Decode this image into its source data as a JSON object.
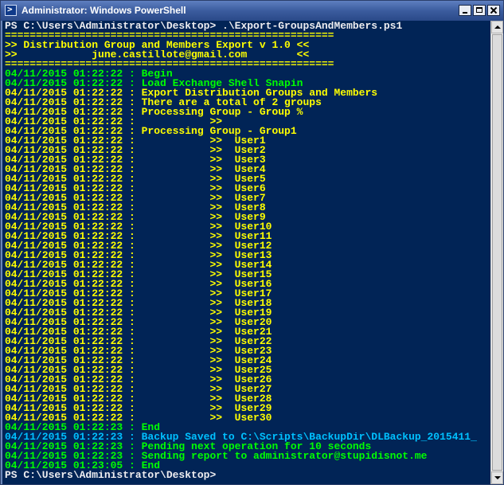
{
  "window": {
    "title": "Administrator: Windows PowerShell",
    "icon": "powershell-icon"
  },
  "colors": {
    "background": "#012456",
    "foreground": "#eeedf0",
    "yellow": "#ffff00",
    "green": "#00ff00",
    "cyan": "#00c0ff"
  },
  "console": {
    "lines": [
      {
        "text": "PS C:\\Users\\Administrator\\Desktop> .\\Export-GroupsAndMembers.ps1",
        "color": "#eeedf0"
      },
      {
        "text": "=====================================================",
        "color": "#ffff00"
      },
      {
        "text": ">> Distribution Group and Members Export v 1.0 <<",
        "color": "#ffff00"
      },
      {
        "text": ">>            june.castillote@gmail.com        <<",
        "color": "#ffff00"
      },
      {
        "text": "=====================================================",
        "color": "#ffff00"
      },
      {
        "text": "04/11/2015 01:22:22 : Begin",
        "color": "#00ff00"
      },
      {
        "text": "04/11/2015 01:22:22 : Load Exchange Shell Snapin",
        "color": "#00ff00"
      },
      {
        "text": "04/11/2015 01:22:22 : Export Distribution Groups and Members",
        "color": "#ffff00"
      },
      {
        "text": "04/11/2015 01:22:22 : There are a total of 2 groups",
        "color": "#ffff00"
      },
      {
        "text": "04/11/2015 01:22:22 : Processing Group - Group %",
        "color": "#ffff00"
      },
      {
        "text": "04/11/2015 01:22:22 :            >>",
        "color": "#ffff00"
      },
      {
        "text": "04/11/2015 01:22:22 : Processing Group - Group1",
        "color": "#ffff00"
      },
      {
        "text": "04/11/2015 01:22:22 :            >>  User1",
        "color": "#ffff00"
      },
      {
        "text": "04/11/2015 01:22:22 :            >>  User2",
        "color": "#ffff00"
      },
      {
        "text": "04/11/2015 01:22:22 :            >>  User3",
        "color": "#ffff00"
      },
      {
        "text": "04/11/2015 01:22:22 :            >>  User4",
        "color": "#ffff00"
      },
      {
        "text": "04/11/2015 01:22:22 :            >>  User5",
        "color": "#ffff00"
      },
      {
        "text": "04/11/2015 01:22:22 :            >>  User6",
        "color": "#ffff00"
      },
      {
        "text": "04/11/2015 01:22:22 :            >>  User7",
        "color": "#ffff00"
      },
      {
        "text": "04/11/2015 01:22:22 :            >>  User8",
        "color": "#ffff00"
      },
      {
        "text": "04/11/2015 01:22:22 :            >>  User9",
        "color": "#ffff00"
      },
      {
        "text": "04/11/2015 01:22:22 :            >>  User10",
        "color": "#ffff00"
      },
      {
        "text": "04/11/2015 01:22:22 :            >>  User11",
        "color": "#ffff00"
      },
      {
        "text": "04/11/2015 01:22:22 :            >>  User12",
        "color": "#ffff00"
      },
      {
        "text": "04/11/2015 01:22:22 :            >>  User13",
        "color": "#ffff00"
      },
      {
        "text": "04/11/2015 01:22:22 :            >>  User14",
        "color": "#ffff00"
      },
      {
        "text": "04/11/2015 01:22:22 :            >>  User15",
        "color": "#ffff00"
      },
      {
        "text": "04/11/2015 01:22:22 :            >>  User16",
        "color": "#ffff00"
      },
      {
        "text": "04/11/2015 01:22:22 :            >>  User17",
        "color": "#ffff00"
      },
      {
        "text": "04/11/2015 01:22:22 :            >>  User18",
        "color": "#ffff00"
      },
      {
        "text": "04/11/2015 01:22:22 :            >>  User19",
        "color": "#ffff00"
      },
      {
        "text": "04/11/2015 01:22:22 :            >>  User20",
        "color": "#ffff00"
      },
      {
        "text": "04/11/2015 01:22:22 :            >>  User21",
        "color": "#ffff00"
      },
      {
        "text": "04/11/2015 01:22:22 :            >>  User22",
        "color": "#ffff00"
      },
      {
        "text": "04/11/2015 01:22:22 :            >>  User23",
        "color": "#ffff00"
      },
      {
        "text": "04/11/2015 01:22:22 :            >>  User24",
        "color": "#ffff00"
      },
      {
        "text": "04/11/2015 01:22:22 :            >>  User25",
        "color": "#ffff00"
      },
      {
        "text": "04/11/2015 01:22:22 :            >>  User26",
        "color": "#ffff00"
      },
      {
        "text": "04/11/2015 01:22:22 :            >>  User27",
        "color": "#ffff00"
      },
      {
        "text": "04/11/2015 01:22:22 :            >>  User28",
        "color": "#ffff00"
      },
      {
        "text": "04/11/2015 01:22:22 :            >>  User29",
        "color": "#ffff00"
      },
      {
        "text": "04/11/2015 01:22:22 :            >>  User30",
        "color": "#ffff00"
      },
      {
        "text": "04/11/2015 01:22:23 : End",
        "color": "#00ff00"
      },
      {
        "text": "04/11/2015 01:22:23 : Backup Saved to C:\\Scripts\\BackupDir\\DLBackup_2015411_",
        "color": "#00c0ff"
      },
      {
        "text": "04/11/2015 01:22:23 : Pending next operation for 10 seconds",
        "color": "#00ff00"
      },
      {
        "text": "04/11/2015 01:22:23 : Sending report to administrator@stupidisnot.me",
        "color": "#00ff00"
      },
      {
        "text": "04/11/2015 01:23:05 : End",
        "color": "#00ff00"
      },
      {
        "text": "PS C:\\Users\\Administrator\\Desktop>",
        "color": "#eeedf0"
      }
    ]
  }
}
